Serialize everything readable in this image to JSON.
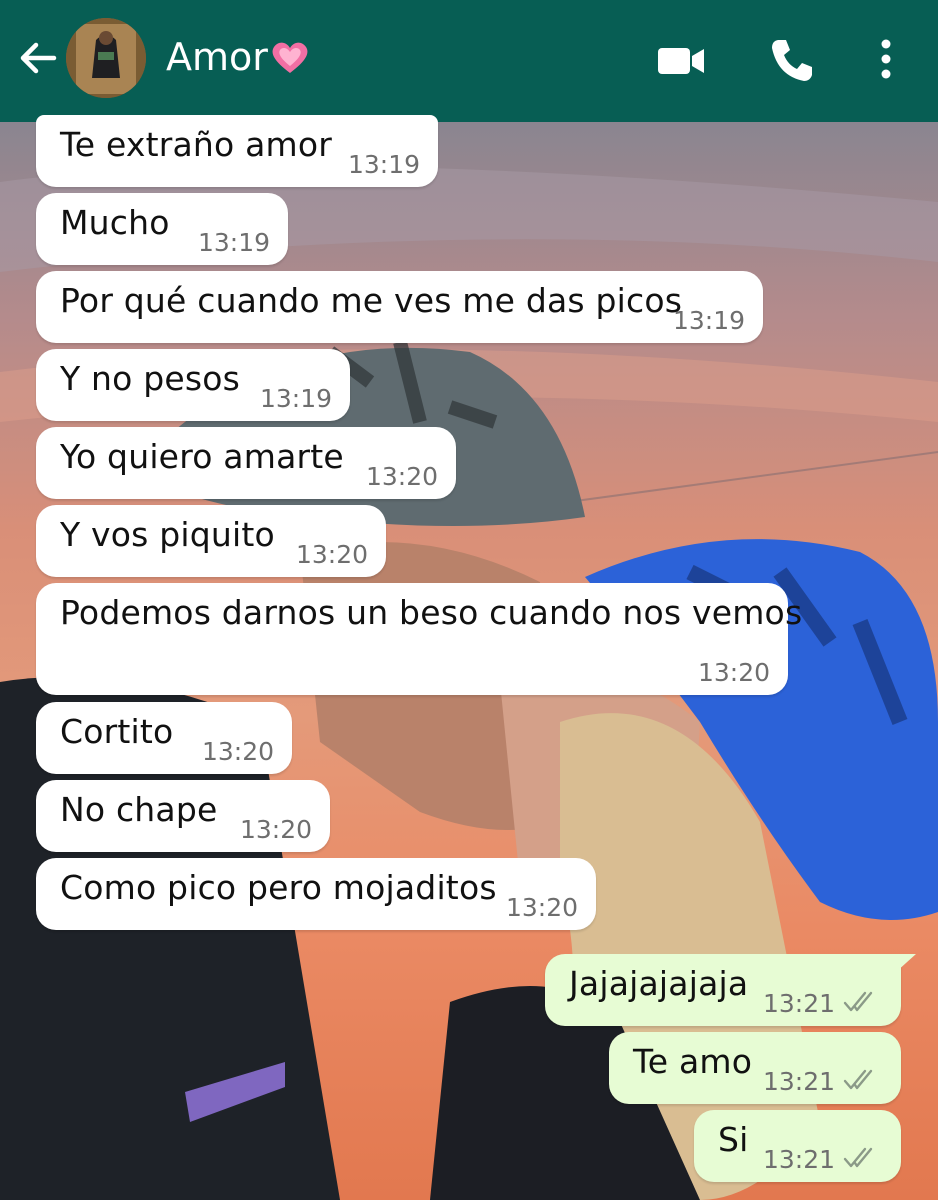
{
  "header": {
    "contact_name": "Amor",
    "back_icon": "arrow-left-icon",
    "heart_icon": "pink-heart-emoji",
    "video_icon": "video-camera-icon",
    "call_icon": "phone-icon",
    "menu_icon": "more-vertical-icon",
    "background_color": "#075e54"
  },
  "messages": [
    {
      "direction": "in",
      "text": "Te extraño amor",
      "time": "13:19"
    },
    {
      "direction": "in",
      "text": "Mucho",
      "time": "13:19"
    },
    {
      "direction": "in",
      "text": "Por qué cuando me ves me das picos",
      "time": "13:19"
    },
    {
      "direction": "in",
      "text": "Y no pesos",
      "time": "13:19"
    },
    {
      "direction": "in",
      "text": "Yo quiero amarte",
      "time": "13:20"
    },
    {
      "direction": "in",
      "text": "Y vos piquito",
      "time": "13:20"
    },
    {
      "direction": "in",
      "text": "Podemos darnos un beso cuando nos vemos",
      "time": "13:20"
    },
    {
      "direction": "in",
      "text": "Cortito",
      "time": "13:20"
    },
    {
      "direction": "in",
      "text": "No chape",
      "time": "13:20"
    },
    {
      "direction": "in",
      "text": "Como pico pero mojaditos",
      "time": "13:20"
    },
    {
      "direction": "out",
      "text": "Jajajajajaja",
      "time": "13:21",
      "status": "read-double-check"
    },
    {
      "direction": "out",
      "text": "Te amo",
      "time": "13:21",
      "status": "read-double-check"
    },
    {
      "direction": "out",
      "text": "Si",
      "time": "13:21",
      "status": "read-double-check"
    }
  ],
  "colors": {
    "incoming_bubble": "#ffffff",
    "outgoing_bubble": "#e7fcd4",
    "timestamp": "#6e6e6e"
  }
}
